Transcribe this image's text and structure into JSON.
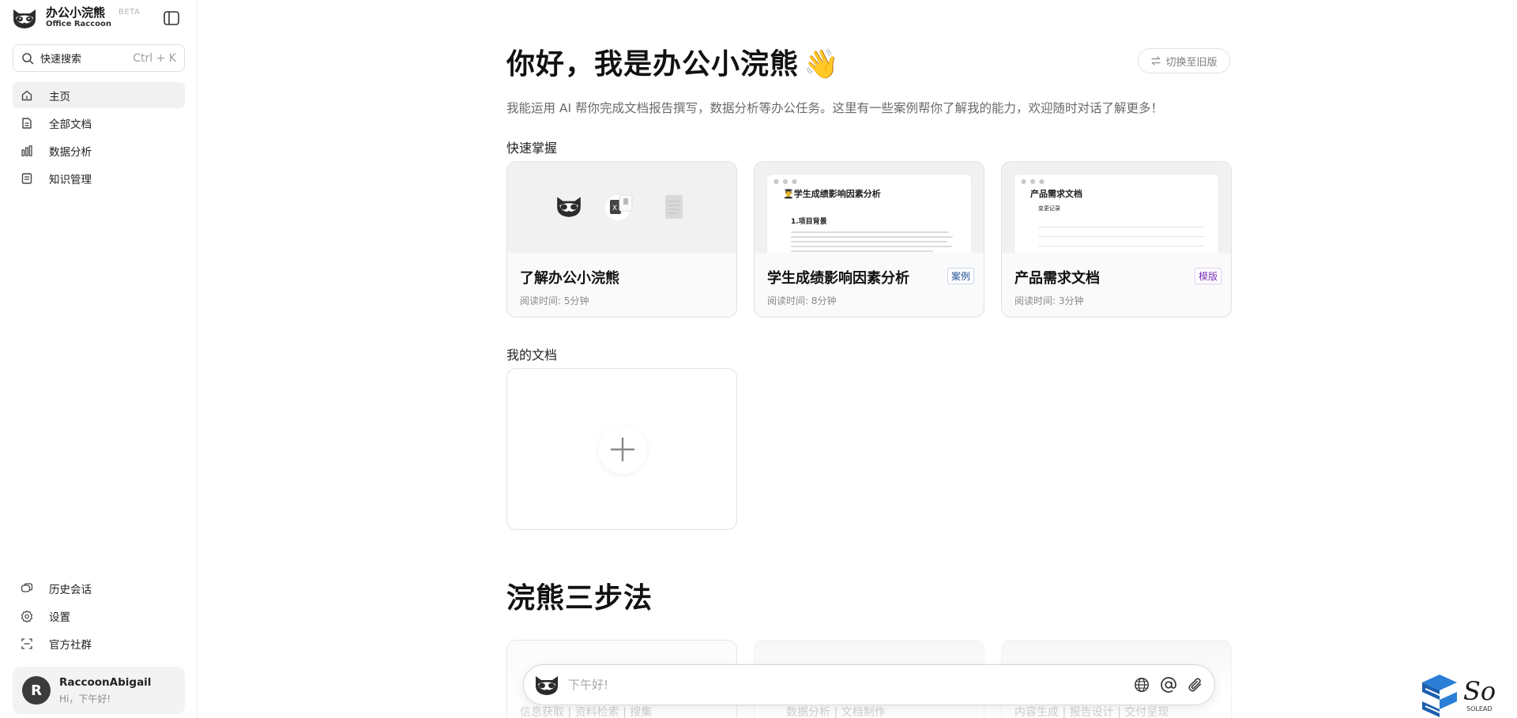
{
  "brand": {
    "name": "办公小浣熊",
    "subtitle": "Office Raccoon",
    "beta": "BETA"
  },
  "search": {
    "label": "快速搜索",
    "shortcut": "Ctrl + K"
  },
  "sidebar": {
    "items": [
      {
        "label": "主页",
        "icon": "home-icon",
        "active": true
      },
      {
        "label": "全部文档",
        "icon": "document-icon",
        "active": false
      },
      {
        "label": "数据分析",
        "icon": "bar-chart-icon",
        "active": false
      },
      {
        "label": "知识管理",
        "icon": "book-icon",
        "active": false
      }
    ],
    "bottom_items": [
      {
        "label": "历史会话",
        "icon": "chat-history-icon"
      },
      {
        "label": "设置",
        "icon": "gear-icon"
      },
      {
        "label": "官方社群",
        "icon": "community-icon"
      }
    ]
  },
  "user": {
    "initial": "R",
    "name": "RaccoonAbigail",
    "greeting": "Hi，下午好!"
  },
  "header": {
    "title": "你好，我是办公小浣熊",
    "emoji": "👋",
    "subtitle": "我能运用 AI 帮你完成文档报告撰写，数据分析等办公任务。这里有一些案例帮你了解我的能力，欢迎随时对话了解更多！",
    "switch_label": "切换至旧版"
  },
  "quick": {
    "label": "快速掌握",
    "cards": [
      {
        "title": "了解办公小浣熊",
        "meta": "阅读时间: 5分钟",
        "badge": "",
        "thumb_title": ""
      },
      {
        "title": "学生成绩影响因素分析",
        "meta": "阅读时间: 8分钟",
        "badge": "案例",
        "badge_color": "#1f4e96",
        "thumb_title": "👨‍🎓学生成绩影响因素分析",
        "thumb_heading": "1.项目背景"
      },
      {
        "title": "产品需求文档",
        "meta": "阅读时间: 3分钟",
        "badge": "模版",
        "badge_color": "#7b2fb5",
        "thumb_title": "产品需求文档",
        "thumb_heading": "变更记录"
      }
    ]
  },
  "mydocs": {
    "label": "我的文档"
  },
  "steps": {
    "title": "浣熊三步法",
    "cards": [
      {
        "text": "信息获取 | 资料检索 | 搜集"
      },
      {
        "text": "数据分析 | 文档制作"
      },
      {
        "text": "内容生成 | 报告设计 | 交付呈现"
      }
    ]
  },
  "chat": {
    "placeholder": "下午好!"
  },
  "watermark": {
    "text": "So",
    "sub": "SOLEAD"
  }
}
